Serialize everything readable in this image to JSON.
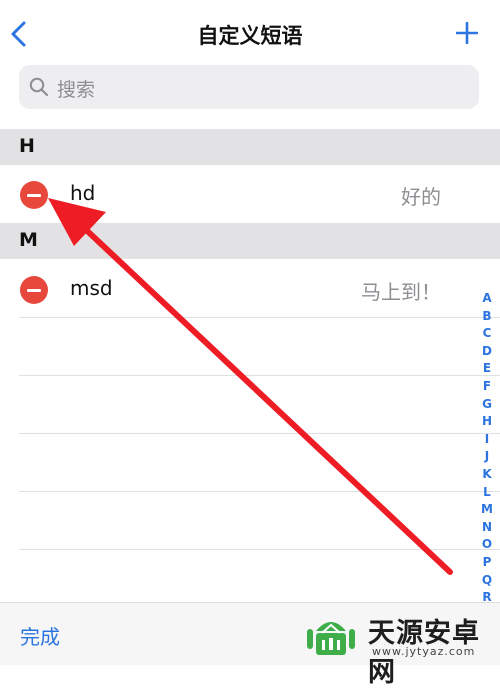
{
  "header": {
    "title": "自定义短语",
    "back_icon": "chevron-left-icon",
    "add_icon": "plus-icon"
  },
  "search": {
    "placeholder": "搜索",
    "icon": "search-icon"
  },
  "sections": [
    {
      "letter": "H",
      "items": [
        {
          "shortcut": "hd",
          "phrase": "好的"
        }
      ]
    },
    {
      "letter": "M",
      "items": [
        {
          "shortcut": "msd",
          "phrase": "马上到！"
        }
      ]
    }
  ],
  "index_letters": [
    "A",
    "B",
    "C",
    "D",
    "E",
    "F",
    "G",
    "H",
    "I",
    "J",
    "K",
    "L",
    "M",
    "N",
    "O",
    "P",
    "Q",
    "R"
  ],
  "toolbar": {
    "done_label": "完成"
  },
  "watermark": {
    "name": "天源安卓网",
    "url": "www.jytyaz.com"
  },
  "colors": {
    "accent": "#2c74e0",
    "delete": "#e8483b",
    "annotation_arrow": "#ee1c24",
    "section_bg": "#e2e2e4"
  }
}
